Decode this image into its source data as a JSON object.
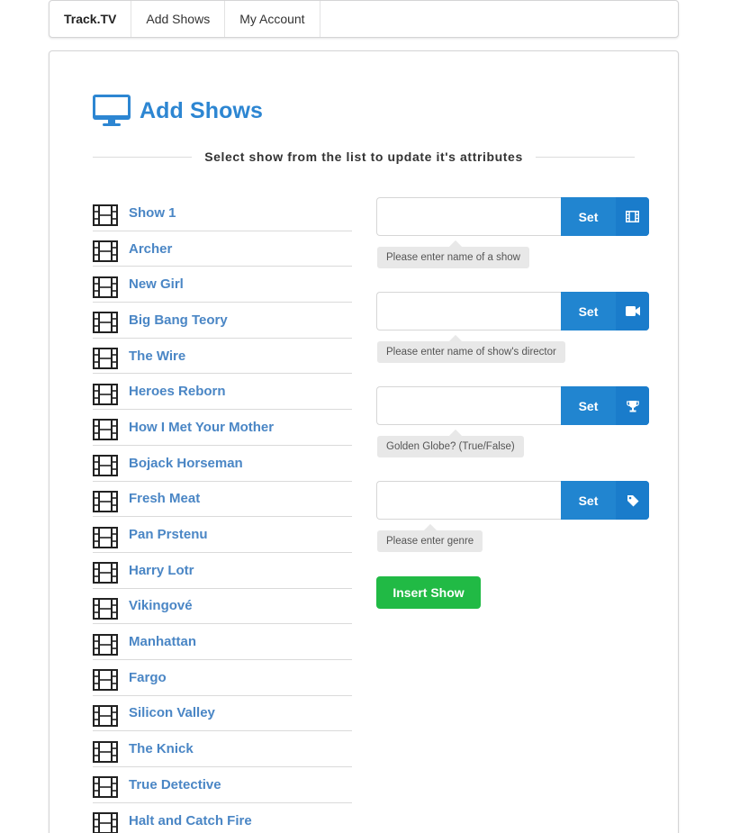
{
  "nav": {
    "brand": "Track.TV",
    "items": [
      "Add Shows",
      "My Account"
    ]
  },
  "page": {
    "title": "Add Shows",
    "subtitle": "Select show from the list to update it's attributes"
  },
  "shows": [
    "Show 1",
    "Archer",
    "New Girl",
    "Big Bang Teory",
    "The Wire",
    "Heroes Reborn",
    "How I Met Your Mother",
    "Bojack Horseman",
    "Fresh Meat",
    "Pan Prstenu",
    "Harry Lotr",
    "Vikingové",
    "Manhattan",
    "Fargo",
    "Silicon Valley",
    "The Knick",
    "True Detective",
    "Halt and Catch Fire"
  ],
  "form": {
    "name_field": {
      "value": "",
      "button": "Set",
      "icon": "film-icon",
      "hint": "Please enter name of a show"
    },
    "director_field": {
      "value": "",
      "button": "Set",
      "icon": "video-camera-icon",
      "hint": "Please enter name of show's director"
    },
    "award_field": {
      "value": "",
      "button": "Set",
      "icon": "trophy-icon",
      "hint": "Golden Globe? (True/False)"
    },
    "genre_field": {
      "value": "",
      "button": "Set",
      "icon": "tag-icon",
      "hint": "Please enter genre"
    },
    "insert_button": "Insert Show"
  },
  "colors": {
    "primary": "#2185d0",
    "title": "#2d86d2",
    "link": "#4a86c5",
    "success": "#21ba45"
  }
}
